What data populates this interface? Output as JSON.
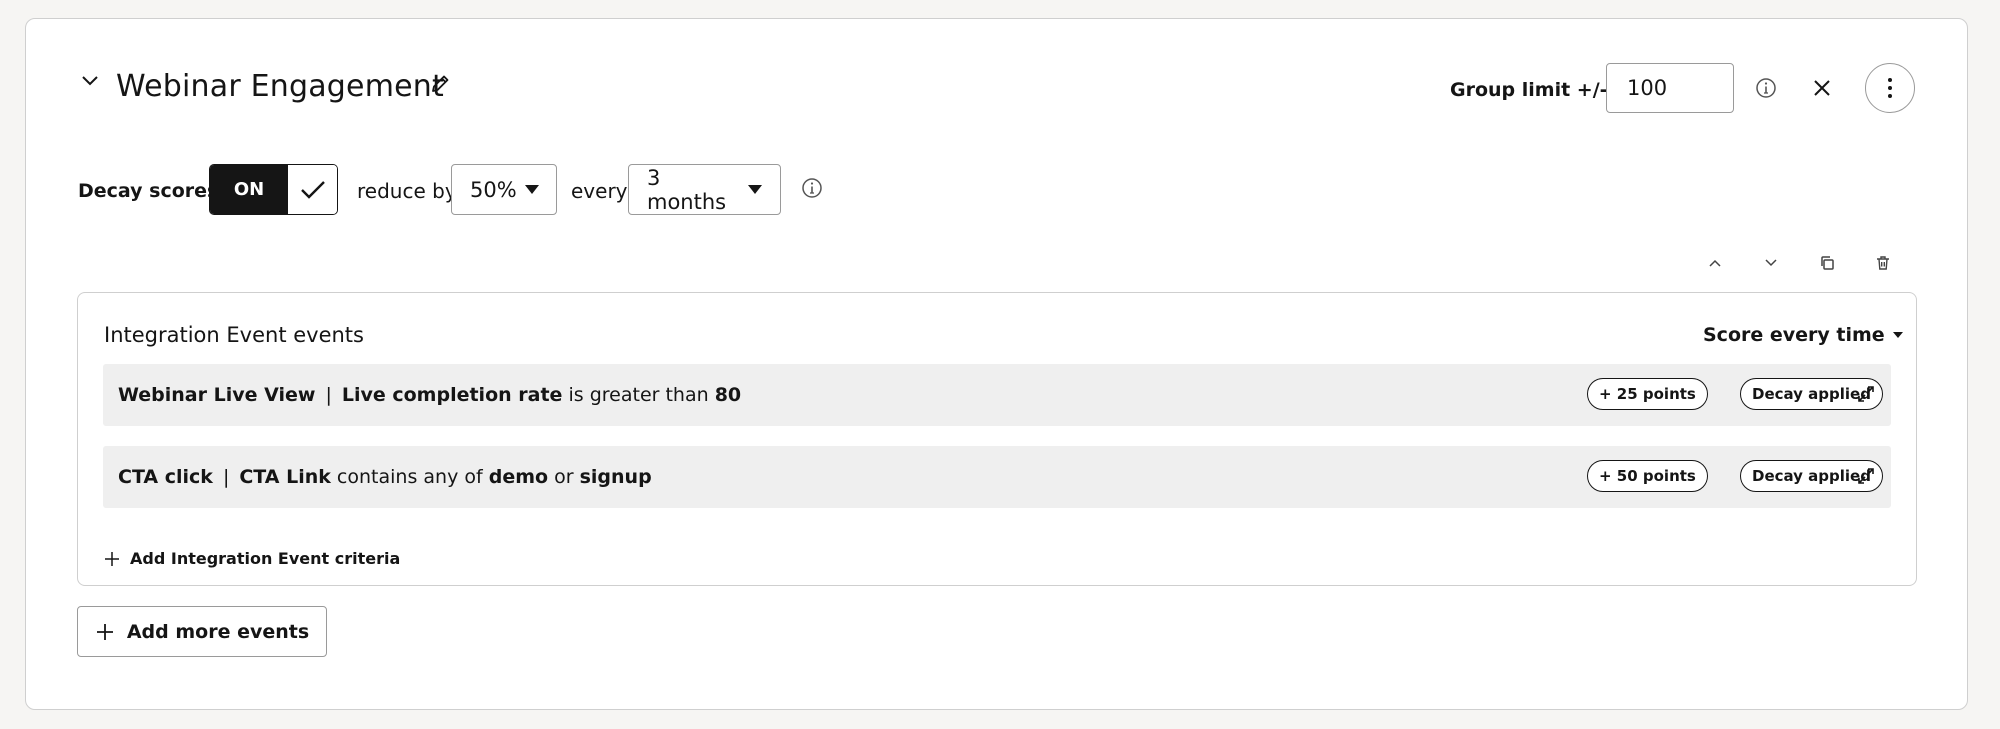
{
  "group": {
    "title": "Webinar Engagement",
    "limit_label": "Group limit +/-",
    "limit_value": "100"
  },
  "decay": {
    "label": "Decay scores",
    "toggle_state": "ON",
    "reduce_label": "reduce by",
    "reduce_value": "50%",
    "every_label": "every",
    "period_value": "3 months"
  },
  "panel": {
    "title": "Integration Event events",
    "score_mode": "Score every time",
    "add_criteria_label": "Add Integration Event criteria",
    "rows": [
      {
        "event": "Webinar Live View",
        "separator": "|",
        "field": "Live completion rate",
        "operator": "is greater than",
        "value": "80",
        "points": "+ 25 points",
        "decay_badge": "Decay applied"
      },
      {
        "event": "CTA click",
        "separator": "|",
        "field": "CTA Link",
        "operator": "contains any of",
        "value1": "demo",
        "joiner": "or",
        "value2": "signup",
        "points": "+ 50 points",
        "decay_badge": "Decay applied"
      }
    ]
  },
  "add_more_label": "Add more events",
  "icons": {
    "collapse": "chevron-down-icon",
    "edit": "pencil-icon",
    "info": "info-icon",
    "close": "close-icon",
    "more": "more-vertical-icon",
    "check": "check-icon",
    "move_up": "chevron-up-icon",
    "move_down": "chevron-down-icon",
    "duplicate": "copy-icon",
    "delete": "trash-icon",
    "expand": "expand-icon",
    "add": "plus-icon"
  },
  "colors": {
    "background": "#f6f5f3",
    "card": "#ffffff",
    "text": "#151515",
    "row_bg": "#efefef",
    "border": "#cfcfcf"
  }
}
